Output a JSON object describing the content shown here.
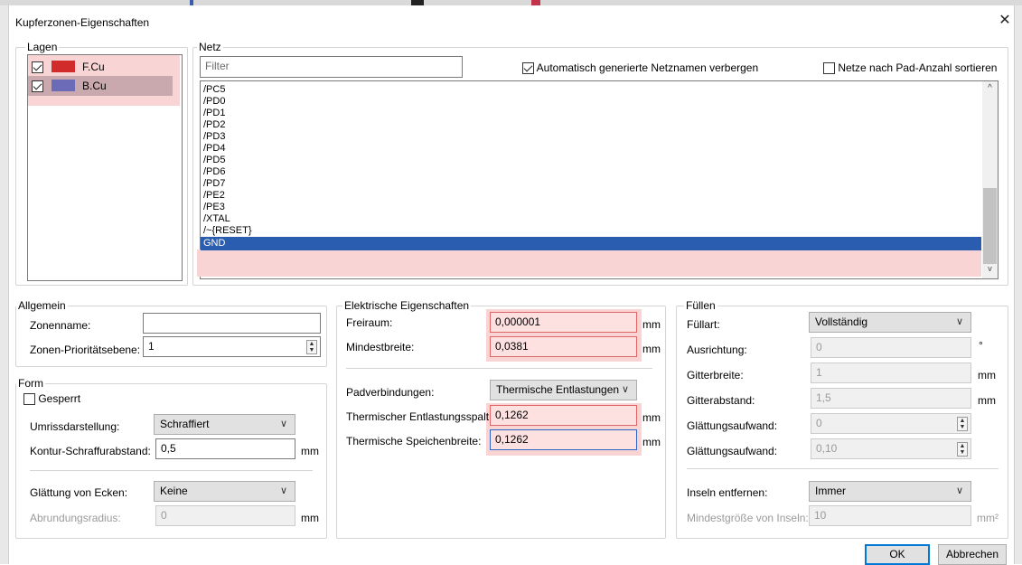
{
  "dialog": {
    "title": "Kupferzonen-Eigenschaften",
    "close_icon": "close-icon"
  },
  "layers": {
    "label": "Lagen",
    "items": [
      {
        "name": "F.Cu",
        "checked": true,
        "color": "#d12b2b"
      },
      {
        "name": "B.Cu",
        "checked": true,
        "color": "#6b6bb8"
      }
    ]
  },
  "net": {
    "label": "Netz",
    "filter_placeholder": "Filter",
    "hide_auto_label": "Automatisch generierte Netznamen verbergen",
    "hide_auto_checked": true,
    "sort_label": "Netze nach Pad-Anzahl sortieren",
    "sort_checked": false,
    "items": [
      "/PC5",
      "/PD0",
      "/PD1",
      "/PD2",
      "/PD3",
      "/PD4",
      "/PD5",
      "/PD6",
      "/PD7",
      "/PE2",
      "/PE3",
      "/XTAL",
      "/~{RESET}",
      "GND"
    ],
    "selected": "GND"
  },
  "general": {
    "label": "Allgemein",
    "zone_name_label": "Zonenname:",
    "zone_name_value": "",
    "priority_label": "Zonen-Prioritätsebene:",
    "priority_value": "1"
  },
  "form": {
    "label": "Form",
    "locked_label": "Gesperrt",
    "outline_label": "Umrissdarstellung:",
    "outline_value": "Schraffiert",
    "hatch_label": "Kontur-Schraffurabstand:",
    "hatch_value": "0,5",
    "hatch_unit": "mm",
    "smoothing_label": "Glättung von Ecken:",
    "smoothing_value": "Keine",
    "radius_label": "Abrundungsradius:",
    "radius_value": "0",
    "radius_unit": "mm"
  },
  "electrical": {
    "label": "Elektrische Eigenschaften",
    "clearance_label": "Freiraum:",
    "clearance_value": "0,000001",
    "clearance_unit": "mm",
    "minwidth_label": "Mindestbreite:",
    "minwidth_value": "0,0381",
    "minwidth_unit": "mm",
    "pad_label": "Padverbindungen:",
    "pad_value": "Thermische Entlastungen",
    "gap_label": "Thermischer Entlastungsspalt:",
    "gap_value": "0,1262",
    "gap_unit": "mm",
    "spoke_label": "Thermische Speichenbreite:",
    "spoke_value": "0,1262",
    "spoke_unit": "mm"
  },
  "fill": {
    "label": "Füllen",
    "mode_label": "Füllart:",
    "mode_value": "Vollständig",
    "orient_label": "Ausrichtung:",
    "orient_value": "0",
    "orient_unit": "°",
    "gridwidth_label": "Gitterbreite:",
    "gridwidth_value": "1",
    "gridwidth_unit": "mm",
    "gridgap_label": "Gitterabstand:",
    "gridgap_value": "1,5",
    "gridgap_unit": "mm",
    "smooth1_label": "Glättungsaufwand:",
    "smooth1_value": "0",
    "smooth2_label": "Glättungsaufwand:",
    "smooth2_value": "0,10",
    "islands_label": "Inseln entfernen:",
    "islands_value": "Immer",
    "minisland_label": "Mindestgröße von Inseln:",
    "minisland_value": "10",
    "minisland_unit": "mm²"
  },
  "buttons": {
    "ok": "OK",
    "cancel": "Abbrechen"
  }
}
